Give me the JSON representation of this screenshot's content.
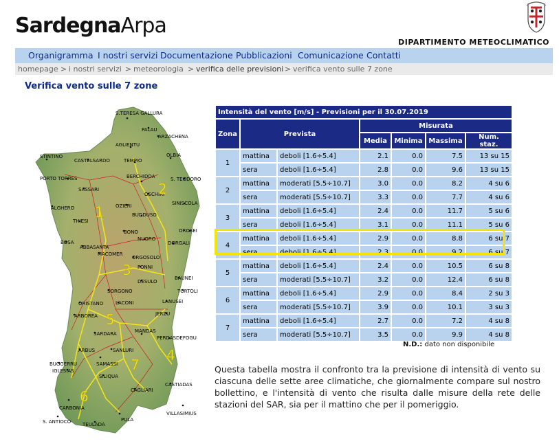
{
  "header": {
    "logo_bold": "Sardegna",
    "logo_light": "Arpa",
    "department": "DIPARTIMENTO METEOCLIMATICO",
    "emblem_icon": "sardinia-coat-of-arms-icon"
  },
  "nav": {
    "items": [
      "Organigramma",
      "I nostri servizi",
      "Documentazione",
      "Pubblicazioni",
      "Comunicazione",
      "Contatti"
    ]
  },
  "breadcrumb": {
    "items": [
      "homepage",
      "i nostri servizi",
      "meteorologia",
      "verifica delle previsioni",
      "verifica vento sulle 7 zone"
    ],
    "separator": ">"
  },
  "page_title": "Verifica vento sulle 7 zone",
  "map": {
    "places": [
      "S.TERESA GALLURA",
      "PALAU",
      "ARZACHENA",
      "AGLIENTU",
      "STINTINO",
      "CASTELSARDO",
      "TEMPIO",
      "OLBIA",
      "BERCHIDDA",
      "PORTO TORRES",
      "SASSARI",
      "S. TEODORO",
      "OSCHIRI",
      "ALGHERO",
      "OZIERI",
      "SINISCOLA",
      "THIESI",
      "BUDDUSO",
      "OROSEI",
      "BOSA",
      "BONO",
      "NUORO",
      "DORGALI",
      "MACOMER",
      "ORGOSOLO",
      "ABBASANTA",
      "FONNI",
      "DESULO",
      "BAUNEI",
      "SORGONO",
      "TORTOLI",
      "ORISTANO",
      "LACONI",
      "LANUSEI",
      "ARBOREA",
      "JERZU",
      "SARDARA",
      "MANDAS",
      "PERDASDEFOGU",
      "ARBUS",
      "SANLURI",
      "SAMASSI",
      "BUGGERRU",
      "IGLESIAS",
      "SILIQUA",
      "CASTIADAS",
      "CAGLIARI",
      "CARBONIA",
      "VILLASIMIUS",
      "S. ANTIOCO",
      "PULA",
      "TEULADA"
    ],
    "zones": [
      "1",
      "2",
      "3",
      "4",
      "5",
      "6",
      "7"
    ]
  },
  "table": {
    "caption": "Intensità del vento [m/s]  -  Previsioni per il 30.07.2019",
    "headers": {
      "zona": "Zona",
      "prevista": "Prevista",
      "misurata": "Misurata",
      "media": "Media",
      "minima": "Minima",
      "massima": "Massima",
      "num_staz": "Num. staz."
    },
    "zones": [
      {
        "zona": "1",
        "rows": [
          {
            "time": "mattina",
            "forecast": "deboli [1.6÷5.4]",
            "media": "2.1",
            "minima": "0.0",
            "massima": "7.5",
            "staz": "13 su 15"
          },
          {
            "time": "sera",
            "forecast": "deboli [1.6÷5.4]",
            "media": "2.8",
            "minima": "0.0",
            "massima": "9.6",
            "staz": "13 su 15"
          }
        ]
      },
      {
        "zona": "2",
        "rows": [
          {
            "time": "mattina",
            "forecast": "moderati [5.5÷10.7]",
            "media": "3.0",
            "minima": "0.0",
            "massima": "8.2",
            "staz": "4 su 6"
          },
          {
            "time": "sera",
            "forecast": "moderati [5.5÷10.7]",
            "media": "3.3",
            "minima": "0.0",
            "massima": "7.7",
            "staz": "4 su 6"
          }
        ]
      },
      {
        "zona": "3",
        "rows": [
          {
            "time": "mattina",
            "forecast": "deboli [1.6÷5.4]",
            "media": "2.4",
            "minima": "0.0",
            "massima": "11.7",
            "staz": "5 su 6"
          },
          {
            "time": "sera",
            "forecast": "deboli [1.6÷5.4]",
            "media": "3.1",
            "minima": "0.0",
            "massima": "11.1",
            "staz": "5 su 6"
          }
        ]
      },
      {
        "zona": "4",
        "rows": [
          {
            "time": "mattina",
            "forecast": "deboli [1.6÷5.4]",
            "media": "2.9",
            "minima": "0.0",
            "massima": "8.8",
            "staz": "6 su 7"
          },
          {
            "time": "sera",
            "forecast": "deboli [1.6÷5.4]",
            "media": "2.3",
            "minima": "0.0",
            "massima": "9.2",
            "staz": "6 su 7"
          }
        ]
      },
      {
        "zona": "5",
        "rows": [
          {
            "time": "mattina",
            "forecast": "deboli [1.6÷5.4]",
            "media": "2.4",
            "minima": "0.0",
            "massima": "10.5",
            "staz": "6 su 8"
          },
          {
            "time": "sera",
            "forecast": "moderati [5.5÷10.7]",
            "media": "3.2",
            "minima": "0.0",
            "massima": "12.4",
            "staz": "6 su 8"
          }
        ]
      },
      {
        "zona": "6",
        "rows": [
          {
            "time": "mattina",
            "forecast": "deboli [1.6÷5.4]",
            "media": "2.9",
            "minima": "0.0",
            "massima": "8.4",
            "staz": "2 su 3"
          },
          {
            "time": "sera",
            "forecast": "moderati [5.5÷10.7]",
            "media": "3.9",
            "minima": "0.0",
            "massima": "10.1",
            "staz": "3 su 3"
          }
        ]
      },
      {
        "zona": "7",
        "rows": [
          {
            "time": "mattina",
            "forecast": "deboli [1.6÷5.4]",
            "media": "2.7",
            "minima": "0.0",
            "massima": "7.2",
            "staz": "4 su 8"
          },
          {
            "time": "sera",
            "forecast": "moderati [5.5÷10.7]",
            "media": "3.5",
            "minima": "0.0",
            "massima": "9.9",
            "staz": "4 su 8"
          }
        ]
      }
    ],
    "highlighted_zone": "4",
    "note_bold": "N.D.:",
    "note_text": "dato non disponibile"
  },
  "description": "Questa tabella mostra il confronto tra la previsione di intensità di vento su ciascuna delle sette aree climatiche, che giornalmente compare sul nostro bollettino, e l'intensità di vento che risulta dalle misure della rete delle stazioni del SAR, sia per il mattino che per il pomeriggio.",
  "colors": {
    "nav_bg": "#b9d3ee",
    "nav_text": "#0b2a8c",
    "table_header": "#1a2a85",
    "cell_bg": "#b9d3ee",
    "highlight": "#f2e600",
    "zone_label": "#f6e41a"
  }
}
